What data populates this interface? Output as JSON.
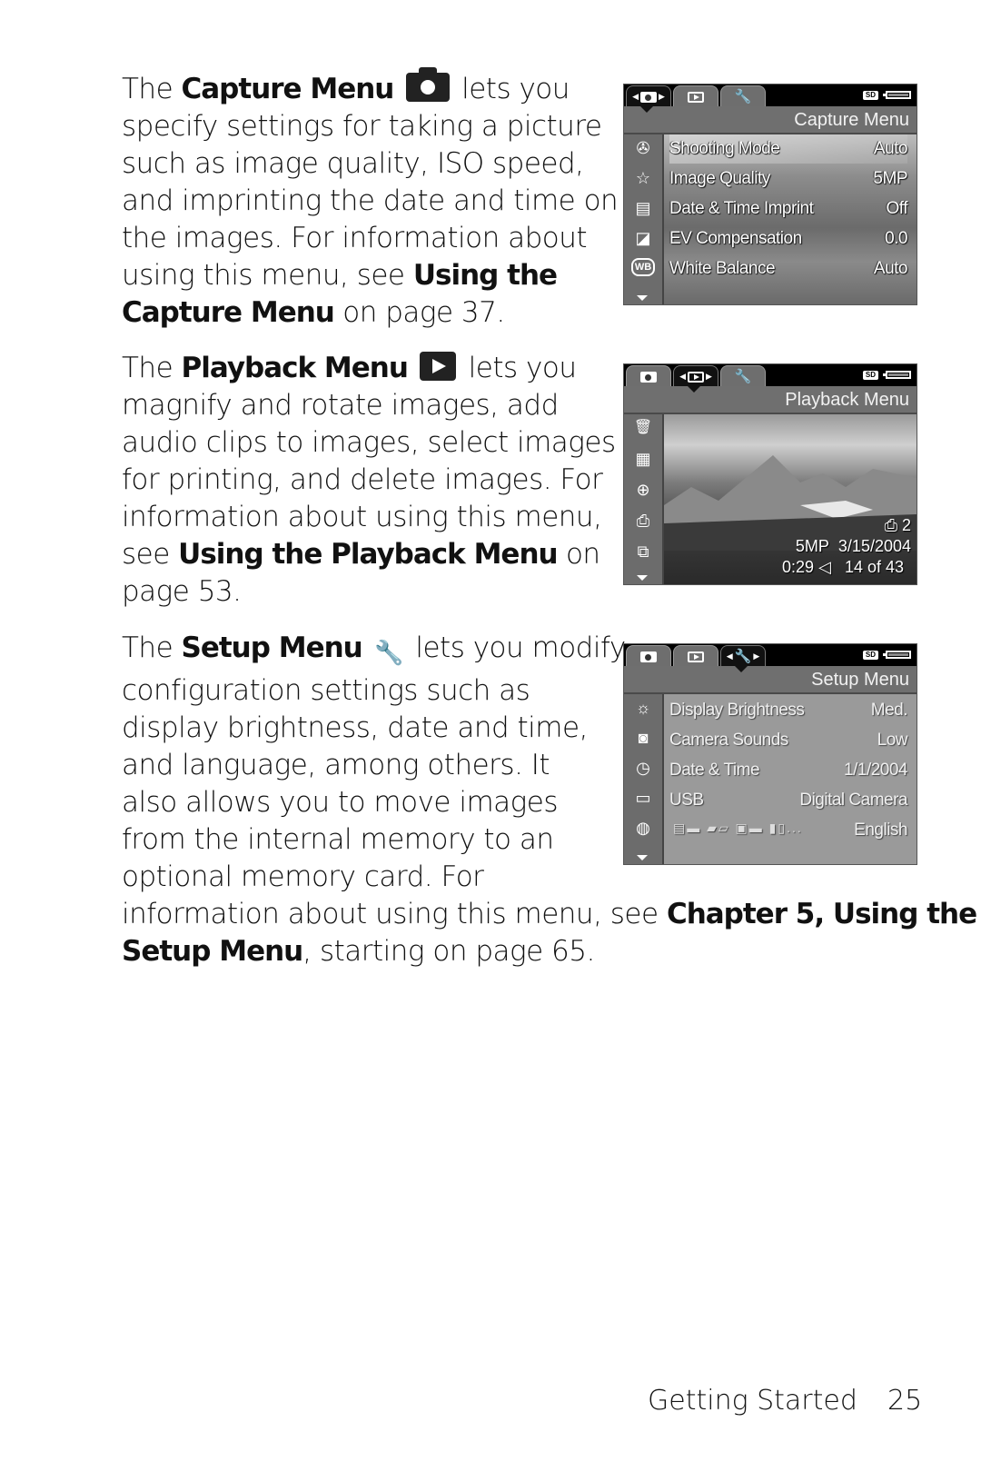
{
  "capture_paragraph": {
    "lines": [
      {
        "pre": "The ",
        "bold": "Capture Menu",
        "icon": "camera-icon",
        "post": " lets you"
      },
      {
        "text": "specify settings for taking a picture"
      },
      {
        "text": "such as image quality, ISO speed,"
      },
      {
        "text": "and imprinting the date and time on"
      },
      {
        "text": "the images. For information about"
      },
      {
        "pre": "using this menu, see ",
        "bold": "Using the"
      },
      {
        "bold_first": "Capture Menu",
        "post": " on page 37."
      }
    ]
  },
  "playback_paragraph": {
    "lines": [
      {
        "pre": "The ",
        "bold": "Playback Menu",
        "icon": "play-icon",
        "post": " lets you"
      },
      {
        "text": "magnify and rotate images, add"
      },
      {
        "text": "audio clips to images, select images"
      },
      {
        "text": "for printing, and delete images. For"
      },
      {
        "text": "information about using this menu,"
      },
      {
        "pre": "see ",
        "bold": "Using the Playback Menu",
        "post": " on"
      },
      {
        "text": "page 53."
      }
    ]
  },
  "setup_paragraph": {
    "lines": [
      {
        "pre": "The ",
        "bold": "Setup Menu",
        "icon": "wrench-icon",
        "post": " lets you modify"
      },
      {
        "text": "configuration settings such as"
      },
      {
        "text": "display brightness, date and time,"
      },
      {
        "text": "and language, among others. It"
      },
      {
        "text": "also allows you to move images"
      },
      {
        "text": "from the internal memory to an"
      },
      {
        "text": "optional memory card. For"
      },
      {
        "pre": "information about using this menu, see ",
        "bold": "Chapter 5, Using the"
      },
      {
        "bold_first": "Setup Menu",
        "post": ", starting on page 65."
      }
    ]
  },
  "icons": {
    "wrench_glyph": "🔧",
    "flags_text": "▤▬ ▰▱ ▣▬ ▮▯...",
    "audio_glyph": "◁",
    "print_glyph": "⎙"
  },
  "screens": {
    "common": {
      "sd_label": "SD"
    },
    "capture": {
      "title": "Capture Menu",
      "active_tab": "capture",
      "items": [
        {
          "icon": "shooting-mode-icon",
          "glyph": "✇",
          "label": "Shooting Mode",
          "value": "Auto"
        },
        {
          "icon": "star-icon",
          "glyph": "☆",
          "label": "Image Quality",
          "value": "5MP"
        },
        {
          "icon": "date-imprint-icon",
          "glyph": "▤",
          "label": "Date & Time Imprint",
          "value": "Off"
        },
        {
          "icon": "ev-compensation-icon",
          "glyph": "◪",
          "label": "EV Compensation",
          "value": "0.0"
        },
        {
          "icon": "white-balance-icon",
          "glyph": "WB",
          "label": "White Balance",
          "value": "Auto"
        }
      ]
    },
    "playback": {
      "title": "Playback Menu",
      "active_tab": "playback",
      "side_icons": [
        {
          "icon": "trash-icon",
          "glyph": "🗑"
        },
        {
          "icon": "thumbnails-icon",
          "glyph": "▦"
        },
        {
          "icon": "magnify-icon",
          "glyph": "⊕"
        },
        {
          "icon": "print-icon",
          "glyph": "⎙"
        },
        {
          "icon": "rotate-icon",
          "glyph": "⧉"
        }
      ],
      "print_count": "2",
      "resolution": "5MP",
      "date": "3/15/2004",
      "audio_length": "0:29",
      "position": "14 of 43"
    },
    "setup": {
      "title": "Setup Menu",
      "active_tab": "setup",
      "items": [
        {
          "icon": "display-brightness-icon",
          "glyph": "☼",
          "label": "Display Brightness",
          "value": "Med."
        },
        {
          "icon": "camera-sounds-icon",
          "glyph": "◙",
          "label": "Camera Sounds",
          "value": "Low"
        },
        {
          "icon": "date-time-icon",
          "glyph": "◷",
          "label": "Date & Time",
          "value": "1/1/2004"
        },
        {
          "icon": "usb-icon",
          "glyph": "▭",
          "label": "USB",
          "value": "Digital Camera"
        },
        {
          "icon": "language-icon",
          "glyph": "◍",
          "label": "",
          "value": "English"
        }
      ]
    }
  },
  "footer": {
    "section": "Getting Started",
    "page_number": "25"
  }
}
